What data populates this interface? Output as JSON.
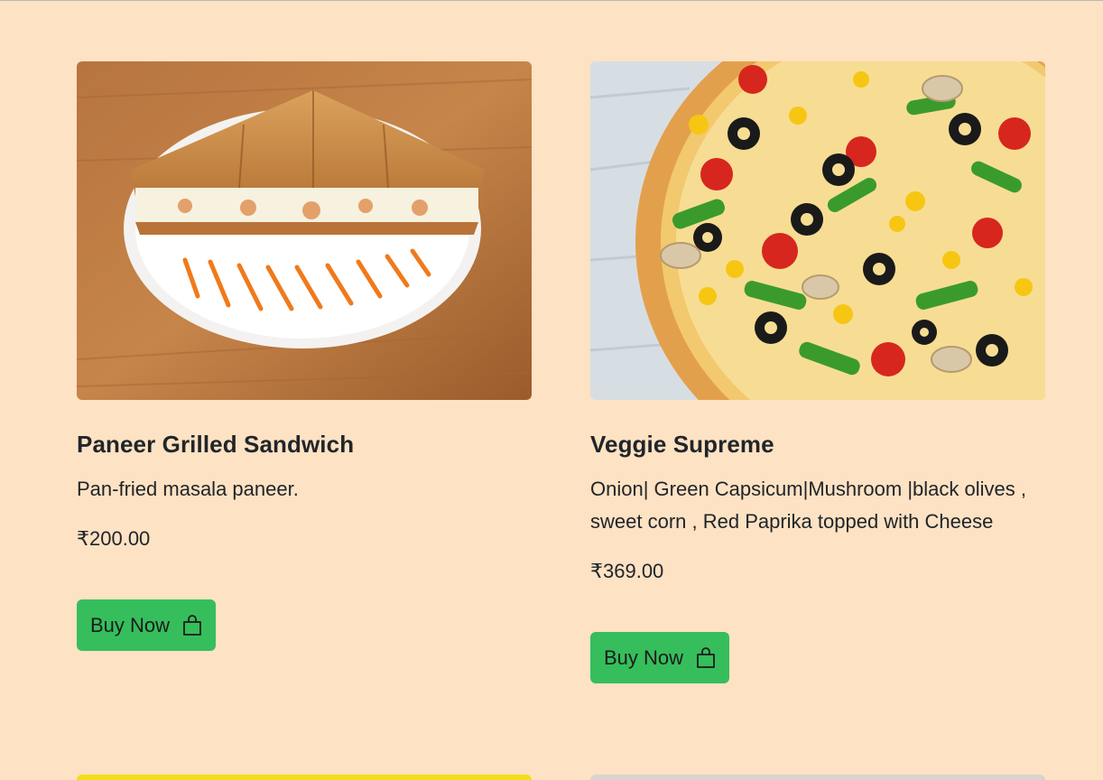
{
  "products": [
    {
      "title": "Paneer Grilled Sandwich",
      "description": "Pan-fried masala paneer.",
      "price": "₹200.00",
      "buy_label": "Buy Now",
      "image_icon": "sandwich-photo"
    },
    {
      "title": "Veggie Supreme",
      "description": "Onion| Green Capsicum|Mushroom |black olives , sweet corn , Red Paprika topped with Cheese",
      "price": "₹369.00",
      "buy_label": "Buy Now",
      "image_icon": "pizza-photo"
    }
  ],
  "colors": {
    "page_background": "#fde2c4",
    "buy_button": "#36be5c",
    "next_card_left": "#f3dd17",
    "next_card_right": "#d9d4cf"
  }
}
